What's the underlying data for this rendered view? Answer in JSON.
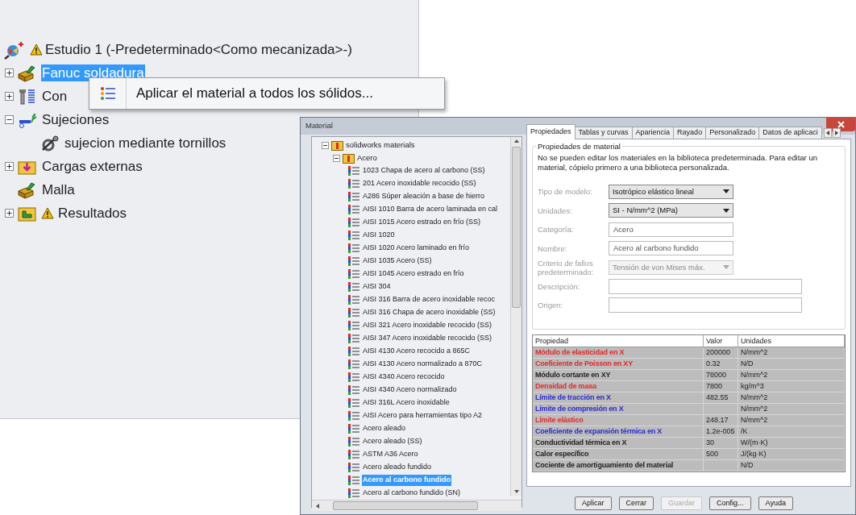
{
  "study_tree": {
    "root": {
      "label": "Estudio 1 (-Predeterminado<Como mecanizada>-)",
      "warning": true
    },
    "items": [
      {
        "label": "Fanuc soldadura",
        "kind": "part",
        "expanded": false,
        "selected": true
      },
      {
        "label": "Con",
        "kind": "connector",
        "expanded": false,
        "selected": false
      },
      {
        "label": "Sujeciones",
        "kind": "fixtures",
        "expanded": true,
        "selected": false,
        "children": [
          {
            "label": "sujecion mediante tornillos",
            "kind": "bolt",
            "selected": false
          }
        ]
      },
      {
        "label": "Cargas externas",
        "kind": "loads",
        "expanded": false,
        "selected": false
      },
      {
        "label": "Malla",
        "kind": "mesh",
        "selected": false
      },
      {
        "label": "Resultados",
        "kind": "results",
        "expanded": false,
        "selected": false,
        "warning": true
      }
    ]
  },
  "context_menu": {
    "items": [
      {
        "label": "Aplicar el material a todos los sólidos..."
      }
    ]
  },
  "material_dialog": {
    "title": "Material",
    "library": {
      "label": "solidworks materials",
      "expanded": true,
      "children": [
        {
          "label": "Acero",
          "expanded": true,
          "items": [
            {
              "label": "1023 Chapa de acero al carbono (SS)",
              "selected": false
            },
            {
              "label": "201 Acero inoxidable recocido (SS)",
              "selected": false
            },
            {
              "label": "A286 Súper aleación a base de hierro",
              "selected": false
            },
            {
              "label": "AISI 1010 Barra de acero laminada en cal",
              "selected": false
            },
            {
              "label": "AISI 1015 Acero estrado en frío (SS)",
              "selected": false
            },
            {
              "label": "AISI 1020",
              "selected": false
            },
            {
              "label": "AISI 1020 Acero laminado en frío",
              "selected": false
            },
            {
              "label": "AISI 1035 Acero (SS)",
              "selected": false
            },
            {
              "label": "AISI 1045 Acero estrado en frío",
              "selected": false
            },
            {
              "label": "AISI 304",
              "selected": false
            },
            {
              "label": "AISI 316 Barra de acero inoxidable recoc",
              "selected": false
            },
            {
              "label": "AISI 316 Chapa de acero inoxidable (SS)",
              "selected": false
            },
            {
              "label": "AISI 321 Acero inoxidable recocido (SS)",
              "selected": false
            },
            {
              "label": "AISI 347 Acero inoxidable recocido (SS)",
              "selected": false
            },
            {
              "label": "AISI 4130 Acero recocido a 865C",
              "selected": false
            },
            {
              "label": "AISI 4130 Acero normalizado a 870C",
              "selected": false
            },
            {
              "label": "AISI 4340 Acero recocido",
              "selected": false
            },
            {
              "label": "AISI 4340 Acero normalizado",
              "selected": false
            },
            {
              "label": "AISI 316L Acero inoxidable",
              "selected": false
            },
            {
              "label": "AISI Acero para herramientas tipo A2",
              "selected": false
            },
            {
              "label": "Acero aleado",
              "selected": false
            },
            {
              "label": "Acero aleado (SS)",
              "selected": false
            },
            {
              "label": "ASTM A36 Acero",
              "selected": false
            },
            {
              "label": "Acero aleado fundido",
              "selected": false
            },
            {
              "label": "Acero al carbono fundido",
              "selected": true
            },
            {
              "label": "Acero al carbono fundido (SN)",
              "selected": false
            }
          ]
        }
      ]
    },
    "tabs": [
      {
        "label": "Propiedades",
        "selected": true
      },
      {
        "label": "Tablas y curvas",
        "selected": false
      },
      {
        "label": "Apariencia",
        "selected": false
      },
      {
        "label": "Rayado",
        "selected": false
      },
      {
        "label": "Personalizado",
        "selected": false
      },
      {
        "label": "Datos de aplicaci",
        "selected": false
      }
    ],
    "group_title": "Propiedades de material",
    "note": "No se pueden editar los materiales en la biblioteca predeterminada. Para editar un material, cópielo primero a una biblioteca personalizada.",
    "fields": [
      {
        "label": "Tipo de modelo:",
        "kind": "select",
        "value": "Isotrópico elástico lineal",
        "disabled": false
      },
      {
        "label": "Unidades:",
        "kind": "select",
        "value": "SI - N/mm^2 (MPa)",
        "disabled": false
      },
      {
        "label": "Categoría:",
        "kind": "text",
        "value": "Acero"
      },
      {
        "label": "Nombre:",
        "kind": "text",
        "value": "Acero al carbono fundido"
      },
      {
        "label": "Criterio de fallos predeterminado:",
        "kind": "select",
        "value": "Tensión de von Mises máx.",
        "disabled": true
      },
      {
        "label": "Descripción:",
        "kind": "wide"
      },
      {
        "label": "Origen:",
        "kind": "wide"
      }
    ],
    "table": {
      "columns": [
        "Propiedad",
        "Valor",
        "Unidades"
      ],
      "rows": [
        {
          "cells": [
            "Módulo de elasticidad en X",
            "200000",
            "N/mm^2"
          ],
          "color": "#e02828"
        },
        {
          "cells": [
            "Coeficiente de Poisson en XY",
            "0.32",
            "N/D"
          ],
          "color": "#e02828"
        },
        {
          "cells": [
            "Módulo cortante en XY",
            "78000",
            "N/mm^2"
          ],
          "color": "#222222"
        },
        {
          "cells": [
            "Densidad de masa",
            "7800",
            "kg/m^3"
          ],
          "color": "#e02828"
        },
        {
          "cells": [
            "Límite de tracción en X",
            "482.55",
            "N/mm^2"
          ],
          "color": "#2a2ad0"
        },
        {
          "cells": [
            "Límite de compresión en X",
            "",
            "N/mm^2"
          ],
          "color": "#2a2ad0"
        },
        {
          "cells": [
            "Límite elástico",
            "248.17",
            "N/mm^2"
          ],
          "color": "#e02828"
        },
        {
          "cells": [
            "Coeficiente de expansión térmica en X",
            "1.2e-005",
            "/K"
          ],
          "color": "#2a2ad0"
        },
        {
          "cells": [
            "Conductividad térmica en X",
            "30",
            "W/(m·K)"
          ],
          "color": "#222222"
        },
        {
          "cells": [
            "Calor específico",
            "500",
            "J/(kg·K)"
          ],
          "color": "#222222"
        },
        {
          "cells": [
            "Cociente de amortiguamiento del material",
            "",
            "N/D"
          ],
          "color": "#222222"
        }
      ]
    },
    "buttons": [
      {
        "label": "Aplicar",
        "disabled": false
      },
      {
        "label": "Cerrar",
        "disabled": false
      },
      {
        "label": "Guardar",
        "disabled": true
      },
      {
        "label": "Config...",
        "disabled": false
      },
      {
        "label": "Ayuda",
        "disabled": false
      }
    ]
  }
}
